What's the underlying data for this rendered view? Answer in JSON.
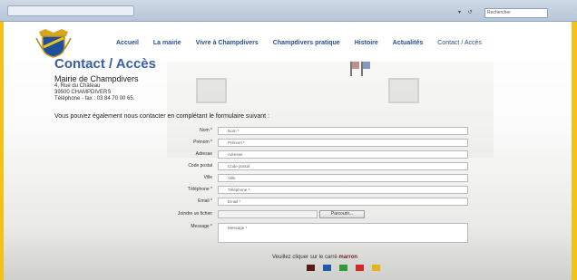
{
  "browser": {
    "search_placeholder": "Rechercher"
  },
  "nav": {
    "items": [
      "Accueil",
      "La mairie",
      "Vivre à Champdivers",
      "Champdivers pratique",
      "Histoire",
      "Actualités",
      "Contact / Accès"
    ]
  },
  "page": {
    "title": "Contact / Accès",
    "org_name": "Mairie de Champdivers",
    "address_line1": "4, Rue du Château",
    "address_line2": "39500 CHAMPDIVERS",
    "phone_line": "Téléphone - fax : 03 84 70 00 65.",
    "intro": "Vous pouvez également nous contacter en complétant le formulaire suivant :"
  },
  "form": {
    "fields": [
      {
        "label": "Nom *",
        "placeholder": "Nom *"
      },
      {
        "label": "Prénom *",
        "placeholder": "Prénom *"
      },
      {
        "label": "Adresse",
        "placeholder": "Adresse"
      },
      {
        "label": "Code postal",
        "placeholder": "Code postal"
      },
      {
        "label": "Ville",
        "placeholder": "Ville"
      },
      {
        "label": "Téléphone *",
        "placeholder": "Téléphone *"
      },
      {
        "label": "Email *",
        "placeholder": "Email *"
      }
    ],
    "file_label": "Joindre un fichier",
    "browse_label": "Parcourir...",
    "message_label": "Message *",
    "message_placeholder": "Message *"
  },
  "captcha": {
    "prefix": "Veuillez cliquer sur le carré",
    "color_word": "marron",
    "swatches": [
      "#5a1a1a",
      "#1e5aa8",
      "#2f9a3a",
      "#d22a2a",
      "#e8b316"
    ]
  }
}
